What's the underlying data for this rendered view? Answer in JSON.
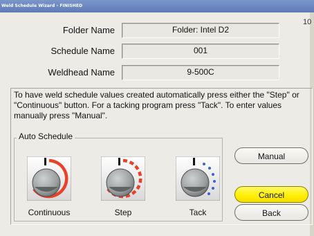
{
  "window": {
    "title": "Weld Schedule Wizard - FINISHED",
    "corner_text": "10"
  },
  "fields": [
    {
      "label": "Folder Name",
      "value": "Folder: Intel D2"
    },
    {
      "label": "Schedule Name",
      "value": "001"
    },
    {
      "label": "Weldhead Name",
      "value": "9-500C"
    }
  ],
  "instructions": "To have weld schedule values created automatically press either the \"Step\" or \"Continuous\" button. For a tacking program press \"Tack\". To enter values manually press \"Manual\".",
  "auto_schedule": {
    "legend": "Auto Schedule",
    "options": [
      {
        "label": "Continuous",
        "icon": "continuous-dial-icon"
      },
      {
        "label": "Step",
        "icon": "step-dial-icon"
      },
      {
        "label": "Tack",
        "icon": "tack-dial-icon"
      }
    ]
  },
  "buttons": {
    "manual": "Manual",
    "cancel": "Cancel",
    "back": "Back"
  },
  "colors": {
    "titlebar": "#6b87c0",
    "arc_red": "#e8412a",
    "dots_blue": "#3a63d6",
    "cancel_yellow": "#ffee00"
  }
}
